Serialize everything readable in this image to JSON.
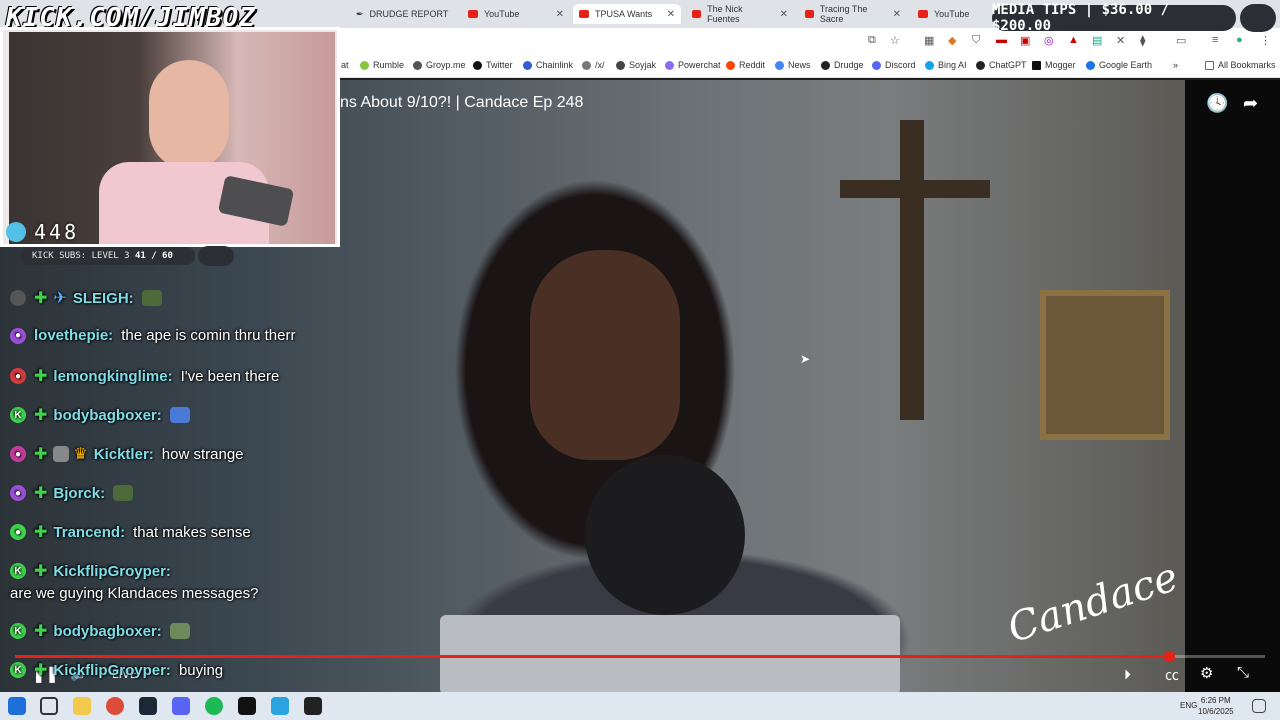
{
  "tabs": [
    {
      "label": "DRUDGE REPORT",
      "icon": "drudge-icon"
    },
    {
      "label": "YouTube",
      "icon": "youtube-icon"
    },
    {
      "label": "TPUSA Wants",
      "icon": "youtube-icon"
    },
    {
      "label": "The Nick Fuentes",
      "icon": "youtube-icon"
    },
    {
      "label": "Tracing The Sacre",
      "icon": "youtube-icon"
    },
    {
      "label": "YouTube",
      "icon": "youtube-icon"
    }
  ],
  "bookmarks": [
    {
      "label": "at",
      "color": "#888"
    },
    {
      "label": "Rumble",
      "color": "#85c742"
    },
    {
      "label": "Groyp.me",
      "color": "#555"
    },
    {
      "label": "Twitter",
      "color": "#111"
    },
    {
      "label": "Chainlink",
      "color": "#375bd2"
    },
    {
      "label": "/x/",
      "color": "#777"
    },
    {
      "label": "Soyjak",
      "color": "#444"
    },
    {
      "label": "Powerchat",
      "color": "#8a6cf0"
    },
    {
      "label": "Reddit",
      "color": "#ff4500"
    },
    {
      "label": "News",
      "color": "#4285f4"
    },
    {
      "label": "Drudge",
      "color": "#222"
    },
    {
      "label": "Discord",
      "color": "#5865f2"
    },
    {
      "label": "Bing AI",
      "color": "#0ea5e9"
    },
    {
      "label": "ChatGPT",
      "color": "#222"
    },
    {
      "label": "Mogger",
      "color": "#111"
    },
    {
      "label": "Google Earth",
      "color": "#1a73e8"
    },
    {
      "label": "All Bookmarks",
      "color": "#666"
    }
  ],
  "video": {
    "title": "ns About 9/10?! | Candace Ep 248",
    "signature": "Candace",
    "progress": 0.923,
    "live_label": "LIVE"
  },
  "overlay": {
    "channel_url": "KICK.COM/JIMBOZ",
    "viewer_count": "448",
    "kick_subs": "KICK SUBS: LEVEL 3",
    "kick_subs_progress": "41 / 60",
    "media_tips": "MEDIA TIPS | $36.00 / $200.00"
  },
  "chat": [
    {
      "user": "SLEIGH:",
      "text": "",
      "badge_color": "#555",
      "badge_glyph": "",
      "emote": true
    },
    {
      "user": "lovethepie:",
      "text": "the ape is comin thru therr",
      "badge_color": "#9b4fd6",
      "badge_glyph": ""
    },
    {
      "user": "lemongkinglime:",
      "text": "I've been there",
      "badge_color": "#d43b3b",
      "badge_glyph": ""
    },
    {
      "user": "bodybagboxer:",
      "text": "",
      "badge_color": "#3ed34d",
      "badge_glyph": "K",
      "emote": true
    },
    {
      "user": "Kicktler:",
      "text": "how strange",
      "badge_color": "#c43b9a",
      "badge_glyph": ""
    },
    {
      "user": "Bjorck:",
      "text": "",
      "badge_color": "#9b4fd6",
      "badge_glyph": "",
      "emote": true
    },
    {
      "user": "Trancend:",
      "text": "that makes sense",
      "badge_color": "#3ed34d",
      "badge_glyph": ""
    },
    {
      "user": "KickflipGroyper:",
      "text": "",
      "badge_color": "#3ed34d",
      "badge_glyph": "K"
    },
    {
      "user": "",
      "text": "are we guying Klandaces messages?",
      "badge_color": "",
      "badge_glyph": ""
    },
    {
      "user": "bodybagboxer:",
      "text": "",
      "badge_color": "#3ed34d",
      "badge_glyph": "K",
      "emote": true
    },
    {
      "user": "KickflipGroyper:",
      "text": "buying",
      "badge_color": "#3ed34d",
      "badge_glyph": "K"
    }
  ],
  "taskbar": {
    "lang": "ENG",
    "time": "6:26 PM",
    "date": "10/6/2025"
  },
  "colors": {
    "accent_red": "#e62117",
    "chat_user": "#7fdde8",
    "kick_green": "#3ed34d"
  }
}
